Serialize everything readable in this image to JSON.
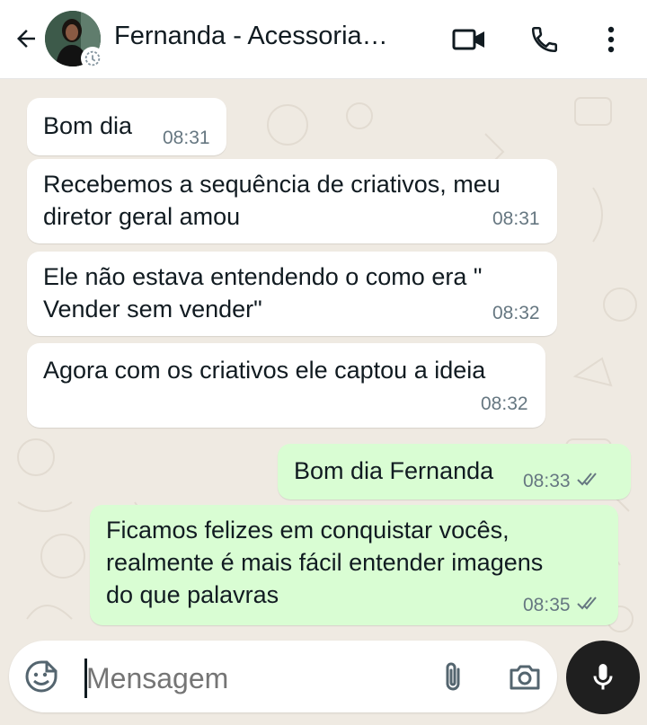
{
  "header": {
    "contact_name": "Fernanda - Acessoria…"
  },
  "messages": [
    {
      "direction": "in",
      "text": "Bom dia",
      "time": "08:31"
    },
    {
      "direction": "in",
      "text": "Recebemos a sequência de criativos, meu diretor geral amou",
      "line1": "Recebemos a sequência de criativos, meu",
      "line2": "diretor geral amou",
      "time": "08:31"
    },
    {
      "direction": "in",
      "text": "Ele não estava entendendo o como era \" Vender sem vender\"",
      "line1": "Ele não estava entendendo o como era \"",
      "line2": "Vender sem vender\"",
      "time": "08:32"
    },
    {
      "direction": "in",
      "text": "Agora com os criativos ele captou a ideia",
      "time": "08:32"
    },
    {
      "direction": "out",
      "text": "Bom dia Fernanda",
      "time": "08:33",
      "status": "read"
    },
    {
      "direction": "out",
      "text": "Ficamos felizes em conquistar vocês, realmente é mais fácil entender imagens do que palavras",
      "line1": "Ficamos felizes em conquistar vocês,",
      "line2": "realmente é mais fácil entender imagens",
      "line3": "do que palavras",
      "time": "08:35",
      "status": "read"
    }
  ],
  "composer": {
    "placeholder": "Mensagem"
  },
  "colors": {
    "chat_background": "#efeae2",
    "incoming_bubble": "#ffffff",
    "outgoing_bubble": "#d9fdd3",
    "mic_button": "#1f1f1f",
    "timestamp": "#667781"
  },
  "icons": {
    "back": "arrow-left-icon",
    "video": "video-camera-icon",
    "call": "phone-icon",
    "menu": "more-vertical-icon",
    "emoji": "sticker-smile-icon",
    "attach": "paperclip-icon",
    "camera": "camera-icon",
    "mic": "microphone-icon"
  }
}
